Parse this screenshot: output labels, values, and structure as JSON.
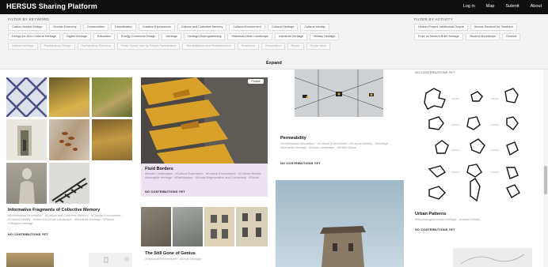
{
  "header": {
    "brand": "HERSUS Sharing Platform",
    "nav": [
      "Log in",
      "Map",
      "Submit",
      "About"
    ]
  },
  "filters": {
    "keywords_heading": "FILTER BY KEYWORD",
    "activity_heading": "FILTER BY ACTIVITY",
    "keywords_row1": [
      "Carbon Neutral Design",
      "Circular Economy",
      "Conservation",
      "Densification",
      "Creative Expressions",
      "Cultural and Collective Memory",
      "Cultural Environment",
      "Cultural Heritage",
      "Cultural Identity"
    ],
    "keywords_row2": [
      "Design for All in Cultural Heritage",
      "Digital Heritage",
      "Education",
      "Energy Conscious Design",
      "Heritage",
      "Heritage Reprogramming",
      "Historical Urban Landscape",
      "Industrial Heritage",
      "Military Heritage"
    ],
    "keywords_row3": [
      "Natural Heritage",
      "Participatory Design",
      "Participatory Planning",
      "Public Space Use by People Participation",
      "Rehabilitation and Refurbishment",
      "Resilience",
      "Restoration",
      "Reuse",
      "Social Value"
    ],
    "activity_row1": [
      "Hersus Project: Intellectual Output",
      "Hersus Seminar for Teachers"
    ],
    "activity_row2": [
      "Prize on Modern Built Heritage",
      "Student Workshops",
      "General"
    ],
    "expand_label": "Expand"
  },
  "cards": {
    "informative": {
      "title": "Informative Fragments of Collective Memory",
      "tags": "#Architectural Information · #Cultural and Collective Memory · #Cultural Environment · #Cultural Identity · #Historical Urban Landscape · #Industrial Heritage · #Places · #Tangible Heritage",
      "contrib": "NO CONTRIBUTIONS YET"
    },
    "fluid": {
      "title": "Fluid Borders",
      "badge": "Project",
      "tags": "#Border Landscapes · #Cultural Expression · #Cultural Environment · #Cultural Identity · #Intangible Heritage · #Participatory · #Social Regeneration and Community · #Social",
      "contrib": "NO CONTRIBUTIONS YET"
    },
    "genius": {
      "title": "The Still Gone of Genius",
      "tags": "#Historical Environment · #Urban Heritage"
    },
    "permeability": {
      "title": "Permeability",
      "tags": "#Architectural Information · #Cultural Environment · #Cultural Identity · #Heritage · #Industrial Heritage · #Urban Landscape · #Public Space",
      "contrib": "NO CONTRIBUTIONS YET"
    },
    "urban": {
      "header_tag": "NO CONTRIBUTIONS YET",
      "title": "Urban Patterns",
      "tags": "#Morphological Urban Heritage · #Urban Density",
      "contrib": "NO CONTRIBUTIONS YET"
    }
  },
  "colors": {
    "topbar": "#0f0f0f",
    "filter_bg": "#f3f3f3",
    "fluid_card_bg": "#ece2f2",
    "accent": "#111111"
  }
}
